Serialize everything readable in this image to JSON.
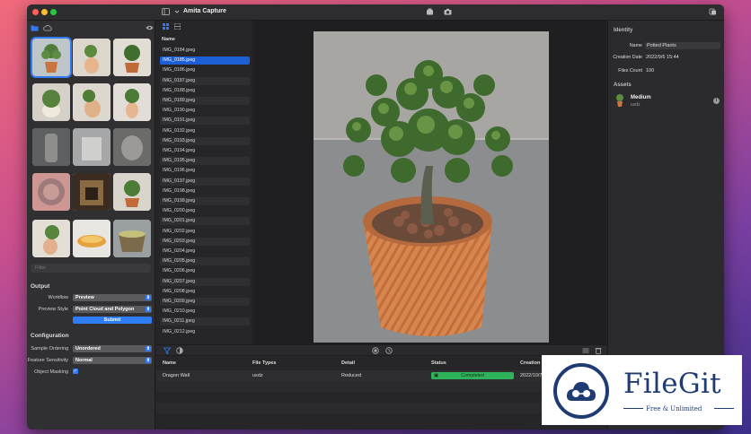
{
  "app": {
    "title": "Amita Capture"
  },
  "sidebar": {
    "filter_placeholder": "Filter",
    "output": {
      "heading": "Output",
      "workflow_label": "Workflow",
      "workflow_value": "Preview",
      "preview_style_label": "Preview Style",
      "preview_style_value": "Point Cloud and Polygon",
      "submit_label": "Submit"
    },
    "configuration": {
      "heading": "Configuration",
      "sample_ordering_label": "Sample Ordering",
      "sample_ordering_value": "Unordered",
      "feature_sensitivity_label": "Feature Sensitivity",
      "feature_sensitivity_value": "Normal",
      "object_masking_label": "Object Masking",
      "object_masking_checked": true
    }
  },
  "file_list": {
    "column_header": "Name",
    "selected_index": 1,
    "files": [
      "IMG_0184.jpeg",
      "IMG_0185.jpeg",
      "IMG_0186.jpeg",
      "IMG_0187.jpeg",
      "IMG_0188.jpeg",
      "IMG_0189.jpeg",
      "IMG_0190.jpeg",
      "IMG_0191.jpeg",
      "IMG_0192.jpeg",
      "IMG_0193.jpeg",
      "IMG_0194.jpeg",
      "IMG_0195.jpeg",
      "IMG_0196.jpeg",
      "IMG_0197.jpeg",
      "IMG_0198.jpeg",
      "IMG_0199.jpeg",
      "IMG_0200.jpeg",
      "IMG_0201.jpeg",
      "IMG_0202.jpeg",
      "IMG_0203.jpeg",
      "IMG_0204.jpeg",
      "IMG_0205.jpeg",
      "IMG_0206.jpeg",
      "IMG_0207.jpeg",
      "IMG_0208.jpeg",
      "IMG_0209.jpeg",
      "IMG_0210.jpeg",
      "IMG_0211.jpeg",
      "IMG_0212.jpeg"
    ]
  },
  "inspector": {
    "identity_heading": "Identity",
    "name_label": "Name",
    "name_value": "Potted Plants",
    "creation_date_label": "Creation Date",
    "creation_date_value": "2022/9/6 15:44",
    "files_count_label": "Files Count",
    "files_count_value": "100",
    "assets_heading": "Assets",
    "asset_name": "Medium",
    "asset_type": "usdz"
  },
  "table": {
    "headers": [
      "Name",
      "File Types",
      "Detail",
      "Status",
      "Creation D"
    ],
    "row": {
      "name": "Dragon Wall",
      "file_type": "usdz",
      "detail": "Reduced",
      "status": "Completed",
      "creation": "2022/10/7"
    }
  },
  "watermark": {
    "brand": "FileGit",
    "tagline": "Free & Unlimited"
  },
  "colors": {
    "accent": "#2f7cf6",
    "status_green": "#2eb35a",
    "brand_navy": "#1f3b73"
  }
}
